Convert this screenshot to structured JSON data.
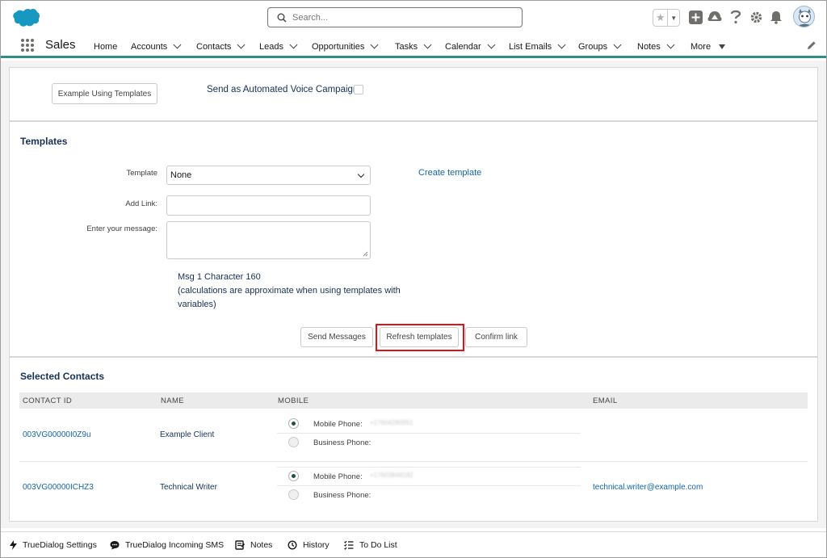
{
  "header": {
    "search_placeholder": "Search...",
    "icons": [
      "salesforce-cloud-logo",
      "search-icon",
      "star-icon",
      "add-icon",
      "trailhead-icon",
      "help-icon",
      "setup-gear-icon",
      "notification-bell-icon",
      "user-avatar"
    ]
  },
  "nav": {
    "app_name": "Sales",
    "items": [
      {
        "label": "Home",
        "has_dropdown": false
      },
      {
        "label": "Accounts",
        "has_dropdown": true
      },
      {
        "label": "Contacts",
        "has_dropdown": true
      },
      {
        "label": "Leads",
        "has_dropdown": true
      },
      {
        "label": "Opportunities",
        "has_dropdown": true
      },
      {
        "label": "Tasks",
        "has_dropdown": true
      },
      {
        "label": "Calendar",
        "has_dropdown": true
      },
      {
        "label": "List Emails",
        "has_dropdown": true
      },
      {
        "label": "Groups",
        "has_dropdown": true
      },
      {
        "label": "Notes",
        "has_dropdown": true
      },
      {
        "label": "More",
        "has_dropdown": true
      }
    ],
    "accent_color": "#2e8f85"
  },
  "top_card": {
    "example_button": "Example Using Templates",
    "voice_campaign_label": "Send as Automated Voice Campaign",
    "voice_campaign_checked": false
  },
  "templates": {
    "title": "Templates",
    "template_label": "Template",
    "template_value": "None",
    "create_template_link": "Create template",
    "add_link_label": "Add Link:",
    "add_link_value": "",
    "message_label": "Enter your message:",
    "message_value": "",
    "msg_count": "Msg 1 Character 160",
    "msg_note_line1": "(calculations are approximate when using templates with",
    "msg_note_line2": "variables)",
    "buttons": {
      "send": "Send Messages",
      "refresh": "Refresh templates",
      "confirm": "Confirm link"
    },
    "highlight_color": "#d9141b"
  },
  "contacts": {
    "title": "Selected Contacts",
    "columns": [
      "CONTACT ID",
      "NAME",
      "MOBILE",
      "EMAIL"
    ],
    "rows": [
      {
        "contact_id": "003VG00000I0Z9u",
        "name": "Example Client",
        "mobile_phone_label": "Mobile Phone:",
        "mobile_phone_value": "+17604280951",
        "mobile_selected": true,
        "business_phone_label": "Business Phone:",
        "business_phone_value": "",
        "email": ""
      },
      {
        "contact_id": "003VG00000ICHZ3",
        "name": "Technical Writer",
        "mobile_phone_label": "Mobile Phone:",
        "mobile_phone_value": "+17603848182",
        "mobile_selected": true,
        "business_phone_label": "Business Phone:",
        "business_phone_value": "",
        "email": "technical.writer@example.com"
      }
    ]
  },
  "utility_bar": {
    "items": [
      {
        "label": "TrueDialog Settings",
        "icon": "lightning-icon"
      },
      {
        "label": "TrueDialog Incoming SMS",
        "icon": "chat-icon"
      },
      {
        "label": "Notes",
        "icon": "notes-icon"
      },
      {
        "label": "History",
        "icon": "history-icon"
      },
      {
        "label": "To Do List",
        "icon": "todo-list-icon"
      }
    ]
  }
}
